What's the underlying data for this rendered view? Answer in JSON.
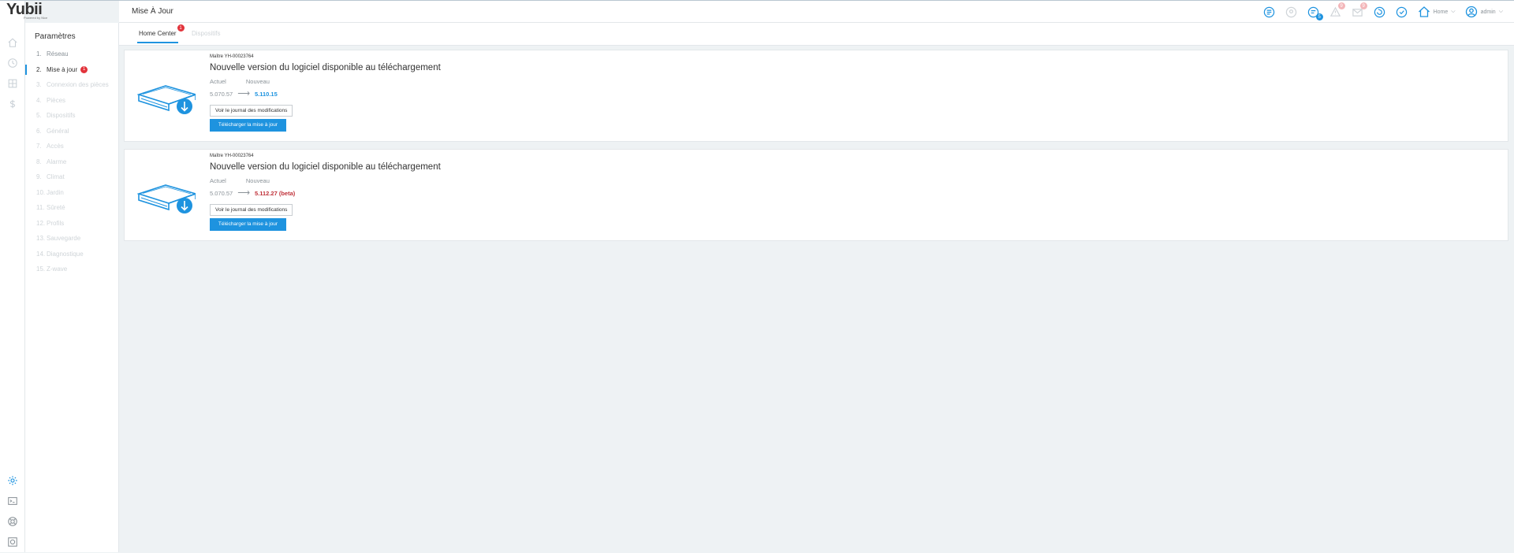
{
  "app": {
    "logo_text": "Yubii",
    "logo_subtext": "Powered by Nice"
  },
  "header": {
    "page_title": "Mise À Jour",
    "notifications": {
      "blue_count": "5",
      "red_count_1": "9",
      "red_count_2": "9"
    },
    "house_label": "Home",
    "user_label": "admin"
  },
  "sidebar": {
    "title": "Paramètres",
    "items": [
      {
        "num": "1.",
        "label": "Réseau"
      },
      {
        "num": "2.",
        "label": "Mise à jour",
        "badge": "1"
      },
      {
        "num": "3.",
        "label": "Connexion des pièces"
      },
      {
        "num": "4.",
        "label": "Pièces"
      },
      {
        "num": "5.",
        "label": "Dispositifs"
      },
      {
        "num": "6.",
        "label": "Général"
      },
      {
        "num": "7.",
        "label": "Accès"
      },
      {
        "num": "8.",
        "label": "Alarme"
      },
      {
        "num": "9.",
        "label": "Climat"
      },
      {
        "num": "10.",
        "label": "Jardin"
      },
      {
        "num": "11.",
        "label": "Sûreté"
      },
      {
        "num": "12.",
        "label": "Profils"
      },
      {
        "num": "13.",
        "label": "Sauvegarde"
      },
      {
        "num": "14.",
        "label": "Diagnostique"
      },
      {
        "num": "15.",
        "label": "Z-wave"
      }
    ]
  },
  "tabs": [
    {
      "label": "Home Center",
      "badge": "1"
    },
    {
      "label": "Dispositifs"
    }
  ],
  "updates": [
    {
      "master": "Maître YH-00023764",
      "heading": "Nouvelle version du logiciel disponible au téléchargement",
      "current_label": "Actuel",
      "new_label": "Nouveau",
      "current_version": "5.070.57",
      "new_version": "5.110.15",
      "log_button": "Voir le journal des modifications",
      "download_button": "Télécharger la mise à jour"
    },
    {
      "master": "Maître YH-00023764",
      "heading": "Nouvelle version du logiciel disponible au téléchargement",
      "current_label": "Actuel",
      "new_label": "Nouveau",
      "current_version": "5.070.57",
      "new_version": "5.112.27 (beta)",
      "log_button": "Voir le journal des modifications",
      "download_button": "Télécharger la mise à jour"
    }
  ],
  "colors": {
    "accent": "#1e93df",
    "beta": "#c0323a",
    "badge": "#e2333b"
  }
}
